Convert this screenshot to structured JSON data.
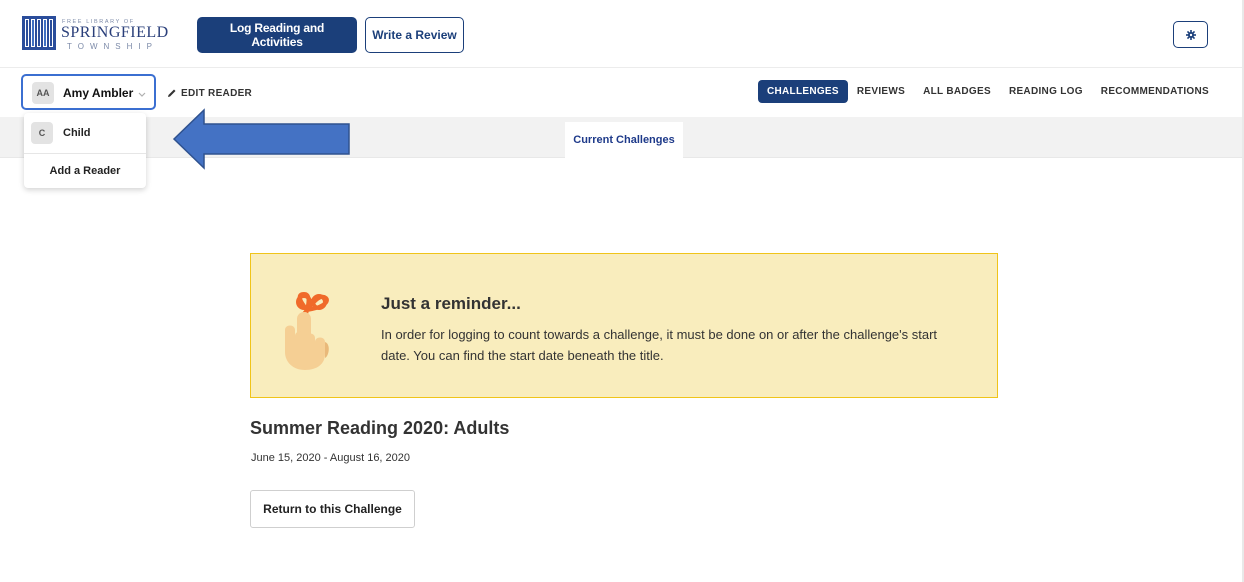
{
  "logo": {
    "small_text": "FREE LIBRARY OF",
    "main_text": "SPRINGFIELD",
    "sub_text": "TOWNSHIP",
    "color": "#2a3f7a"
  },
  "header": {
    "log_button": "Log Reading and Activities",
    "review_button": "Write a Review",
    "settings_icon": "gear-icon"
  },
  "reader": {
    "initials": "AA",
    "name": "Amy Ambler",
    "edit_label": "EDIT READER"
  },
  "nav": {
    "items": [
      {
        "label": "CHALLENGES",
        "active": true
      },
      {
        "label": "REVIEWS",
        "active": false
      },
      {
        "label": "ALL BADGES",
        "active": false
      },
      {
        "label": "READING LOG",
        "active": false
      },
      {
        "label": "RECOMMENDATIONS",
        "active": false
      }
    ]
  },
  "tabs": {
    "current": "Current Challenges"
  },
  "dropdown": {
    "child_initial": "C",
    "child_label": "Child",
    "add_label": "Add a Reader"
  },
  "reminder": {
    "title": "Just a reminder...",
    "body": "In order for logging to count towards a challenge, it must be done on or after the challenge's start date. You can find the start date beneath the title."
  },
  "challenge": {
    "title": "Summer Reading 2020: Adults",
    "dates": "June 15, 2020 - August 16, 2020",
    "return_button": "Return to this Challenge"
  },
  "colors": {
    "primary": "#1b3f7a",
    "focus_border": "#3b6fd1",
    "reminder_bg": "#f9edbd",
    "reminder_border": "#f0c419",
    "arrow_fill": "#4472c4"
  }
}
